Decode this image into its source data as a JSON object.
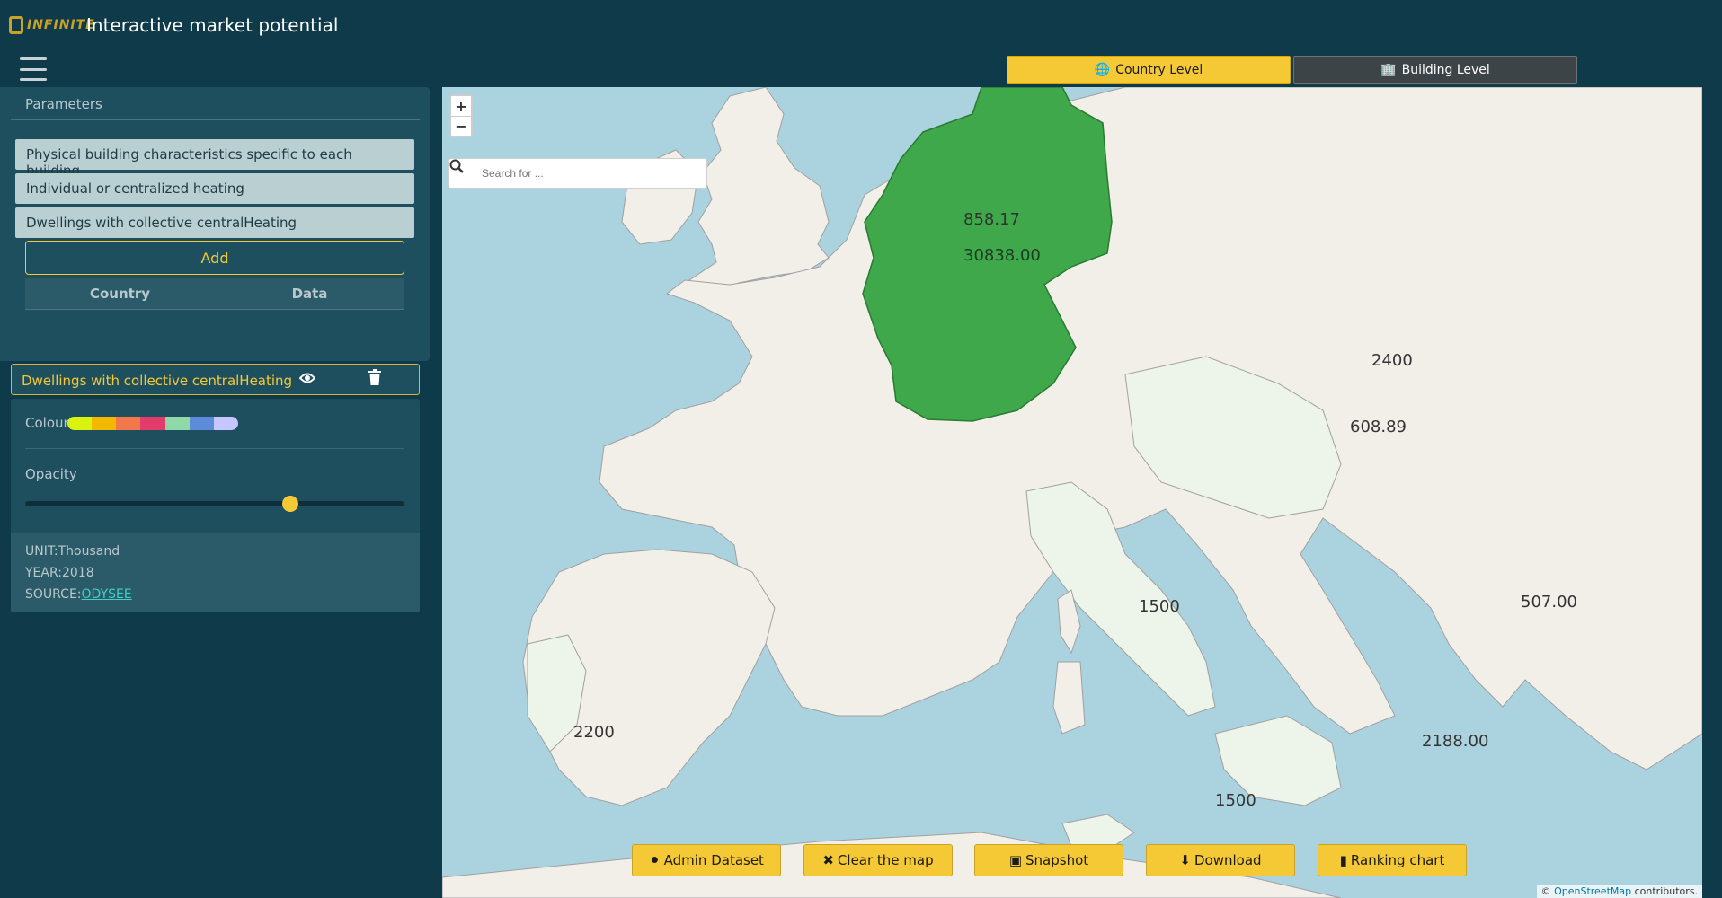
{
  "app": {
    "logo_text": "INFINITE",
    "title": "Interactive market potential"
  },
  "level_toggle": {
    "country_label": "Country Level",
    "building_label": "Building Level"
  },
  "parameters": {
    "heading": "Parameters",
    "items": [
      {
        "label": "Physical building characteristics specific to each building"
      },
      {
        "label": "Individual or centralized heating"
      },
      {
        "label": "Dwellings with collective centralHeating"
      }
    ],
    "add_label": "Add",
    "table_headers": [
      "Country",
      "Data"
    ]
  },
  "layer": {
    "title": "Dwellings with collective centralHeating",
    "colour_label": "Colour",
    "colour_ramp": [
      "#d9f20f",
      "#f5b800",
      "#f2784b",
      "#e33b6a",
      "#8fd9a8",
      "#5b8bd9",
      "#c7c7ff"
    ],
    "opacity_label": "Opacity",
    "opacity_value": 0.7,
    "unit": "UNIT:Thousand",
    "year": "YEAR:2018",
    "source_prefix": "SOURCE:",
    "source_link": "ODYSEE"
  },
  "map": {
    "search_placeholder": "Search for ...",
    "zoom_in": "+",
    "zoom_out": "−",
    "labels": {
      "germany": "30838.00",
      "netherlands": "858.17",
      "poland": "2400",
      "hungary": "608.89",
      "italy": "1500",
      "italy_south": "1500",
      "romania": "507.00",
      "spain": "2200",
      "greece": "2188.00"
    },
    "highlight_color": "#3ea84a",
    "attribution_prefix": "© ",
    "attribution_link": "OpenStreetMap",
    "attribution_suffix": " contributors."
  },
  "actions": {
    "admin": "Admin Dataset",
    "clear": "Clear the map",
    "snapshot": "Snapshot",
    "download": "Download",
    "ranking": "Ranking chart"
  }
}
